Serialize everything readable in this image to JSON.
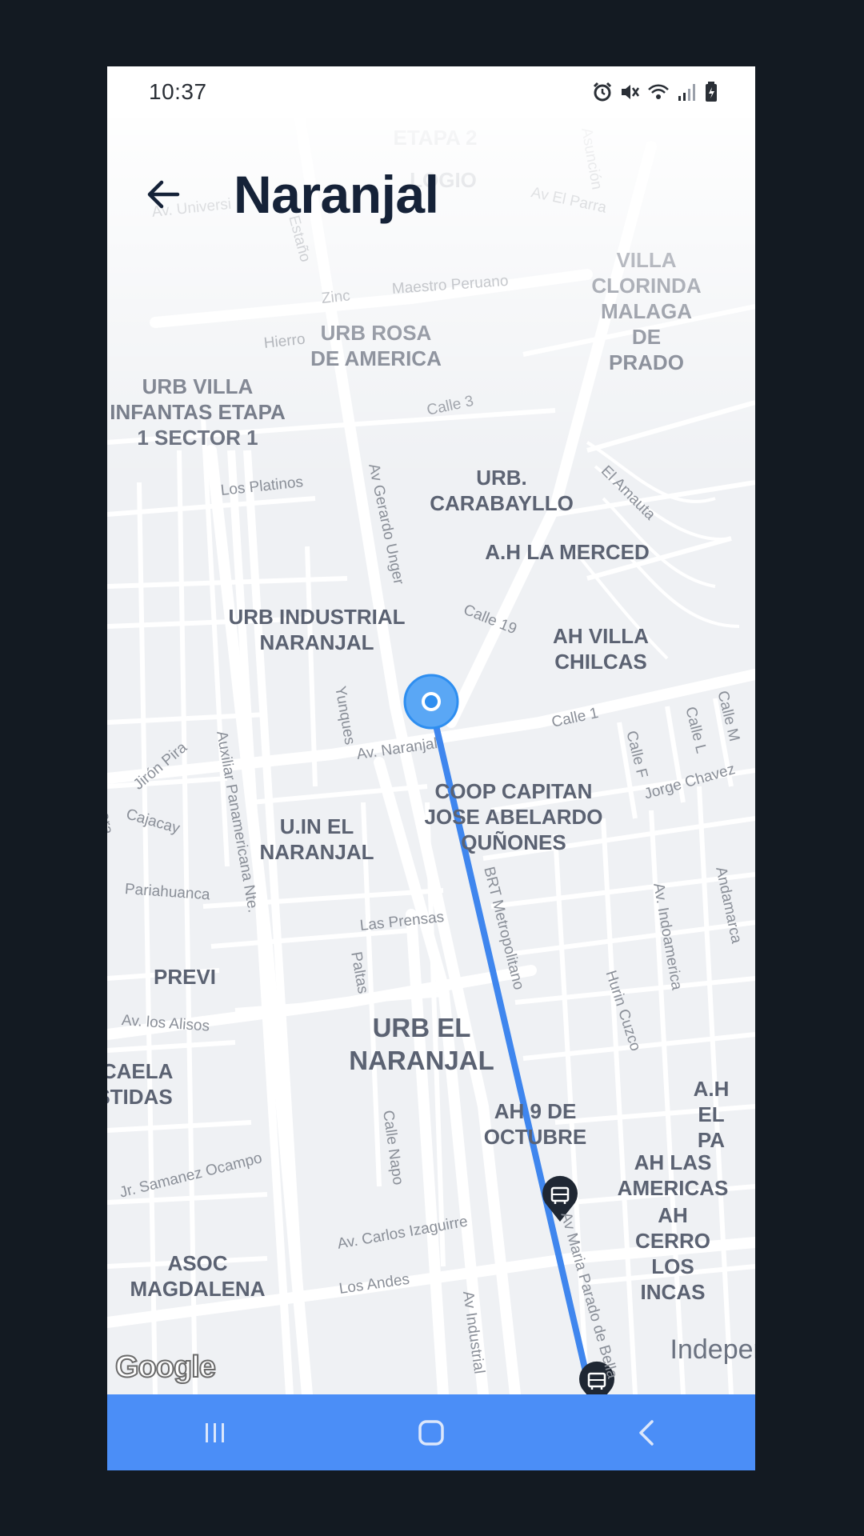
{
  "status_bar": {
    "time": "10:37"
  },
  "header": {
    "title": "Naranjal"
  },
  "map": {
    "area_labels": [
      {
        "text": "URB ROSA\nDE AMERICA"
      },
      {
        "text": "VILLA CLORINDA\nMALAGA\nDE PRADO"
      },
      {
        "text": "URB VILLA\nINFANTAS ETAPA\n1 SECTOR 1"
      },
      {
        "text": "URB.\nCARABAYLLO"
      },
      {
        "text": "A.H LA MERCED"
      },
      {
        "text": "URB INDUSTRIAL\nNARANJAL"
      },
      {
        "text": "AH VILLA\nCHILCAS"
      },
      {
        "text": "COOP CAPITAN\nJOSE ABELARDO\nQUÑONES"
      },
      {
        "text": "U.IN EL\nNARANJAL"
      },
      {
        "text": "PREVI"
      },
      {
        "text": "URB EL\nNARANJAL"
      },
      {
        "text": "ICAELA\nSTIDAS"
      },
      {
        "text": "AH 9 DE\nOCTUBRE"
      },
      {
        "text": "A.H EL PA"
      },
      {
        "text": "AH LAS\nAMERICAS"
      },
      {
        "text": "AH CERRO\nLOS INCAS"
      },
      {
        "text": "ASOC\nMAGDALENA"
      },
      {
        "text": "ETAPA 2"
      },
      {
        "text": "LOGIO"
      }
    ],
    "city_label": "Indepen",
    "street_labels": [
      {
        "text": "Av. Universi"
      },
      {
        "text": "Zinc"
      },
      {
        "text": "Maestro Peruano"
      },
      {
        "text": "Hierro"
      },
      {
        "text": "Calle 3"
      },
      {
        "text": "Av El Parra"
      },
      {
        "text": "Los Platinos"
      },
      {
        "text": "Av Gerardo Unger"
      },
      {
        "text": "El Amauta"
      },
      {
        "text": "Calle 19"
      },
      {
        "text": "Yunques"
      },
      {
        "text": "Av. Naranjal"
      },
      {
        "text": "Calle 1"
      },
      {
        "text": "Calle F"
      },
      {
        "text": "Calle L"
      },
      {
        "text": "Calle M"
      },
      {
        "text": "Jorge Chavez"
      },
      {
        "text": "Jirón Pira"
      },
      {
        "text": "Auxiliar Panamericana Nte."
      },
      {
        "text": "Cajacay"
      },
      {
        "text": "BRT Metropolitano"
      },
      {
        "text": "Av. Indoamerica"
      },
      {
        "text": "Andamarca"
      },
      {
        "text": "Pariahuanca"
      },
      {
        "text": "Las Prensas"
      },
      {
        "text": "Paltas"
      },
      {
        "text": "Hurin Cuzco"
      },
      {
        "text": "Av. los Alisos"
      },
      {
        "text": "Calle Napo"
      },
      {
        "text": "Jr. Samanez Ocampo"
      },
      {
        "text": "Av. Carlos Izaguirre"
      },
      {
        "text": "Los Andes"
      },
      {
        "text": "Av Industrial"
      },
      {
        "text": "Av Maria Parado de Bella"
      },
      {
        "text": "Marcara"
      },
      {
        "text": "Estaño"
      },
      {
        "text": "Asunción"
      }
    ],
    "attribution": "Google"
  },
  "colors": {
    "route": "#3f86ee",
    "location_dot": "#2e8ef0",
    "stop_marker": "#1f2733",
    "nav_bar": "#4b8ef7",
    "title": "#152238"
  },
  "icons": {
    "back": "arrow-left-icon",
    "stop": "bus-stop-marker-icon",
    "location": "current-location-icon",
    "nav_recents": "recents-icon",
    "nav_home": "home-icon",
    "nav_back": "nav-back-icon"
  }
}
